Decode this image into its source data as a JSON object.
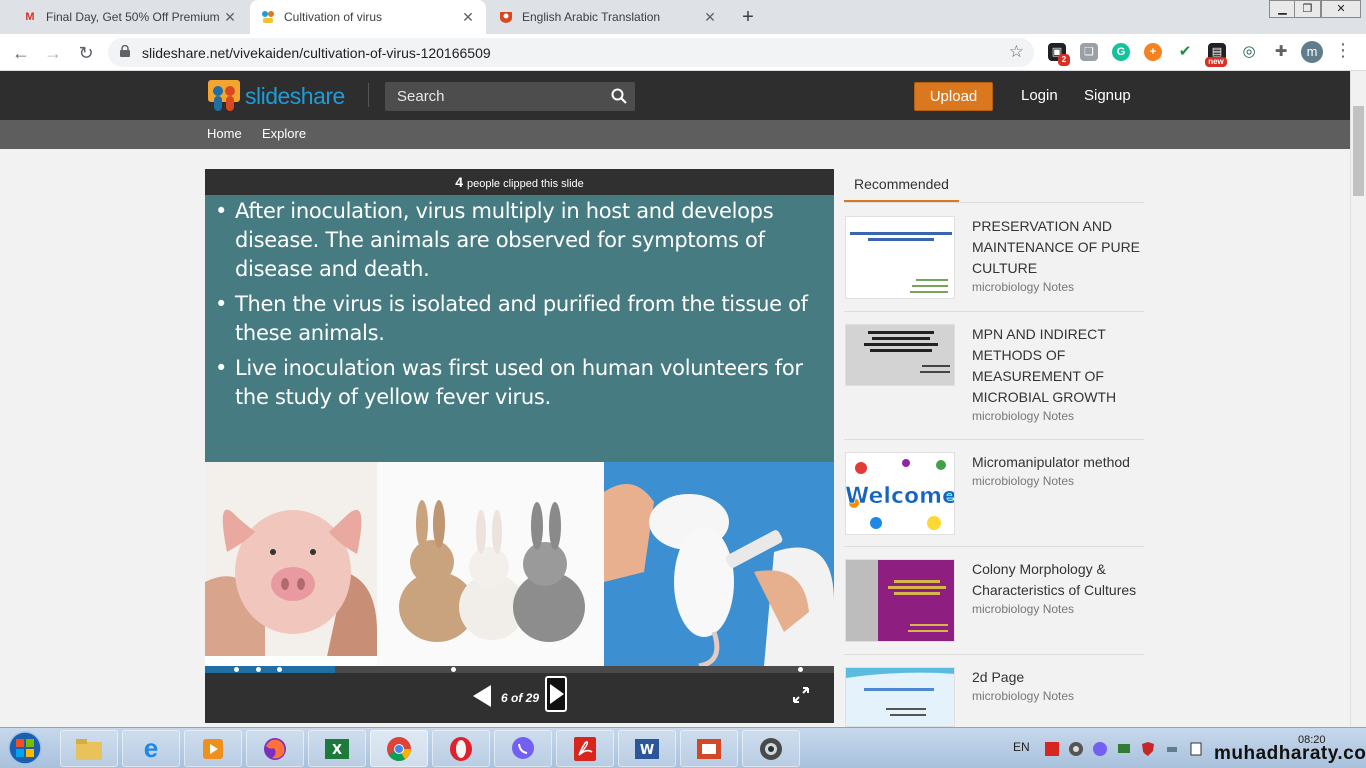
{
  "browser": {
    "tabs": [
      {
        "title": "Final Day, Get 50% Off Premium",
        "favicon": "gmail-icon"
      },
      {
        "title": "Cultivation of virus",
        "favicon": "slideshare-icon",
        "active": true
      },
      {
        "title": "English Arabic Translation",
        "favicon": "translate-icon"
      }
    ],
    "url": "slideshare.net/vivekaiden/cultivation-of-virus-120166509",
    "profile_initial": "m",
    "ext_badge_count": "2",
    "ext_badge_new": "new"
  },
  "header": {
    "logo_text": "slideshare",
    "search_placeholder": "Search",
    "upload_label": "Upload",
    "login_label": "Login",
    "signup_label": "Signup",
    "accent_color": "#d9781f"
  },
  "subnav": {
    "home": "Home",
    "explore": "Explore"
  },
  "player": {
    "clip_count": "4",
    "clip_text": "people clipped this slide",
    "bullets": [
      "After inoculation, virus multiply in host and develops disease. The animals are observed for symptoms of disease and death.",
      "Then the virus is isolated and purified from the tissue of these animals.",
      "Live inoculation was first used on human volunteers for the study of yellow fever virus."
    ],
    "pager": "6 of 29",
    "progress_fraction": 0.207
  },
  "recommended": {
    "tab_label": "Recommended",
    "items": [
      {
        "title": "PRESERVATION AND MAINTENANCE OF PURE CULTURE",
        "source": "microbiology Notes"
      },
      {
        "title": "MPN AND INDIRECT METHODS OF MEASUREMENT OF MICROBIAL GROWTH",
        "source": "microbiology Notes"
      },
      {
        "title": "Micromanipulator method",
        "source": "microbiology Notes"
      },
      {
        "title": "Colony Morphology & Characteristics of Cultures",
        "source": "microbiology Notes"
      },
      {
        "title": "2d Page",
        "source": "microbiology Notes"
      }
    ]
  },
  "taskbar": {
    "language": "EN",
    "time": "08:20"
  },
  "watermark": "muhadharaty.com"
}
